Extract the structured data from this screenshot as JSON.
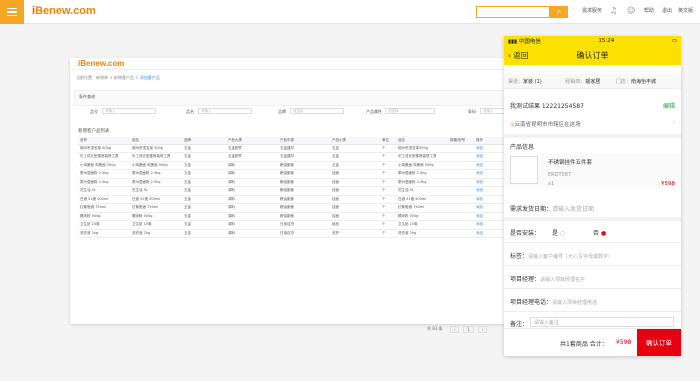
{
  "topbar": {
    "logo_prefix": "i",
    "logo_text": "Benew.com",
    "search_icon": "search-icon",
    "links": [
      "需求服务",
      "帮助",
      "退出",
      "英文版"
    ]
  },
  "panel": {
    "logo": "iBenew.com",
    "breadcrumb_prefix": "当前位置：",
    "breadcrumb": [
      "新增单",
      "新增客户品",
      "添加客户品"
    ],
    "filter_title": "条件查询",
    "filters": [
      {
        "label": "品号",
        "placeholder": "请输入"
      },
      {
        "label": "品名",
        "placeholder": "请输入"
      },
      {
        "label": "品牌",
        "placeholder": "请选择"
      },
      {
        "label": "产品属性",
        "placeholder": "请选择"
      },
      {
        "label": "条码",
        "placeholder": "请输入"
      }
    ],
    "list_title": "新增客户品列表",
    "columns": [
      "品号",
      "品名",
      "品牌",
      "产品大类",
      "产品中类",
      "产品小类",
      "单位",
      "品名",
      "规格/型号",
      "操作"
    ],
    "rows": [
      [
        "锦州吊顶支架 500g",
        "锦州吊顶支架 500g",
        "五金",
        "五金配件",
        "五金建材",
        "五金",
        "个",
        "锦州吊顶支架500g",
        "",
        "添加"
      ],
      [
        "乐工成长型楼房装修工具",
        "乐工成长型楼房装修工具",
        "五金",
        "五金配件",
        "五金建材",
        "五金",
        "个",
        "乐工成长型楼房装修工具",
        "",
        "添加"
      ],
      [
        "小鸡蛋面 鸡蛋面 500g",
        "小鸡蛋面 鸡蛋面 500g",
        "五金",
        "调料",
        "粮油副食",
        "五金",
        "个",
        "小鸡蛋面 鸡蛋面 500g",
        "",
        "添加"
      ],
      [
        "泰州湿面粉 2.5kg",
        "泰州湿面粉 2.5kg",
        "五金",
        "调料",
        "粮油副食",
        "挂面",
        "个",
        "泰州湿面粉 2.5kg",
        "",
        "添加"
      ],
      [
        "泰州湿面粉 2.5kg",
        "泰州湿面粉 2.5kg",
        "五金",
        "调料",
        "粮油副食",
        "挂面",
        "个",
        "泰州湿面粉 2.5kg",
        "",
        "添加"
      ],
      [
        "花生油 5L",
        "花生油 5L",
        "五金",
        "调料",
        "粮油副食",
        "挂面",
        "个",
        "花生油 5L",
        "",
        "添加"
      ],
      [
        "白酒 52度 500ml",
        "白酒 52度 500ml",
        "五金",
        "调料",
        "粮油副食",
        "挂面",
        "个",
        "白酒 52度 500ml",
        "",
        "添加"
      ],
      [
        "红葡萄酒 750ml",
        "红葡萄酒 750ml",
        "五金",
        "调料",
        "粮油副食",
        "挂面",
        "个",
        "红葡萄酒 750ml",
        "",
        "添加"
      ],
      [
        "糯米粉 500g",
        "糯米粉 500g",
        "五金",
        "调料",
        "粮油副食",
        "挂面",
        "个",
        "糯米粉 500g",
        "",
        "添加"
      ],
      [
        "卫生纸 10卷",
        "卫生纸 10卷",
        "五金",
        "调料",
        "日用百货",
        "纸品",
        "个",
        "卫生纸 10卷",
        "",
        "添加"
      ],
      [
        "洗衣液 2kg",
        "洗衣液 2kg",
        "五金",
        "调料",
        "日用百货",
        "洗护",
        "个",
        "洗衣液 2kg",
        "",
        "添加"
      ]
    ],
    "pager": {
      "total": "共 83 条",
      "page": "1"
    }
  },
  "phone": {
    "carrier": "中国电信",
    "time": "15:24",
    "nav_back": "返回",
    "nav_title": "确认订单",
    "channel_label": "渠道：",
    "channel_value": "家装 (1)",
    "dealer_label": "经销商：",
    "dealer_value": "靓家居",
    "store_label": "门店：",
    "store_value": "南海怡丰城",
    "customer": "我测试结果  12221254587",
    "edit_label": "编辑",
    "address": "云南省昆明市市辖区在这场",
    "product_section": "产品信息",
    "product_name": "不锈钢挂件五件套",
    "product_code": "ERDT087",
    "product_qty": "x1",
    "product_price": "¥598",
    "ship_label": "需求发货日期：",
    "ship_placeholder": "请输入发货日期",
    "install_label": "是否安装：",
    "install_yes": "是",
    "install_no": "否",
    "tag_label": "标签：",
    "tag_placeholder": "请输入客户编号（大心写字母或数字）",
    "pm_label": "项目经理：",
    "pm_placeholder": "请输入项目经理名字",
    "pm_phone_label": "项目经理电话：",
    "pm_phone_placeholder": "请输入项目经理电话",
    "remark_label": "备注：",
    "remark_placeholder": "请输入备注",
    "summary": "共1套商品  合计：",
    "total": "¥598",
    "confirm_button": "确认订单"
  },
  "colors": {
    "accent": "#f5a623",
    "yellow": "#fce100",
    "red": "#e60012",
    "green": "#21a147"
  }
}
